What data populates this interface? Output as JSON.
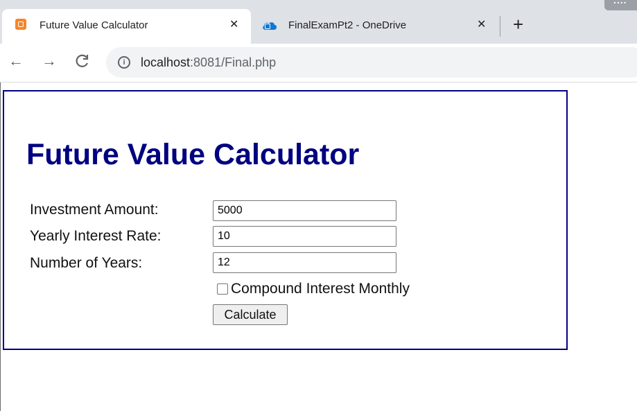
{
  "browser": {
    "tabs": [
      {
        "title": "Future Value Calculator",
        "close": "✕",
        "active": true
      },
      {
        "title": "FinalExamPt2 - OneDrive",
        "close": "✕",
        "active": false
      }
    ],
    "new_tab": "+",
    "nav": {
      "back": "←",
      "forward": "→",
      "reload": "C"
    },
    "address": {
      "host": "localhost",
      "rest": ":8081/Final.php",
      "info": "i"
    }
  },
  "page": {
    "heading": "Future Value Calculator",
    "fields": [
      {
        "label": "Investment Amount:",
        "value": "5000"
      },
      {
        "label": "Yearly Interest Rate:",
        "value": "10"
      },
      {
        "label": "Number of Years:",
        "value": "12"
      }
    ],
    "checkbox": {
      "label": "Compound Interest Monthly",
      "checked": false
    },
    "submit_label": "Calculate"
  },
  "colors": {
    "heading": "#000080",
    "border": "#000080"
  },
  "icons": {
    "tab1": "xampp-icon",
    "tab2": "onedrive-cloud-icon"
  }
}
